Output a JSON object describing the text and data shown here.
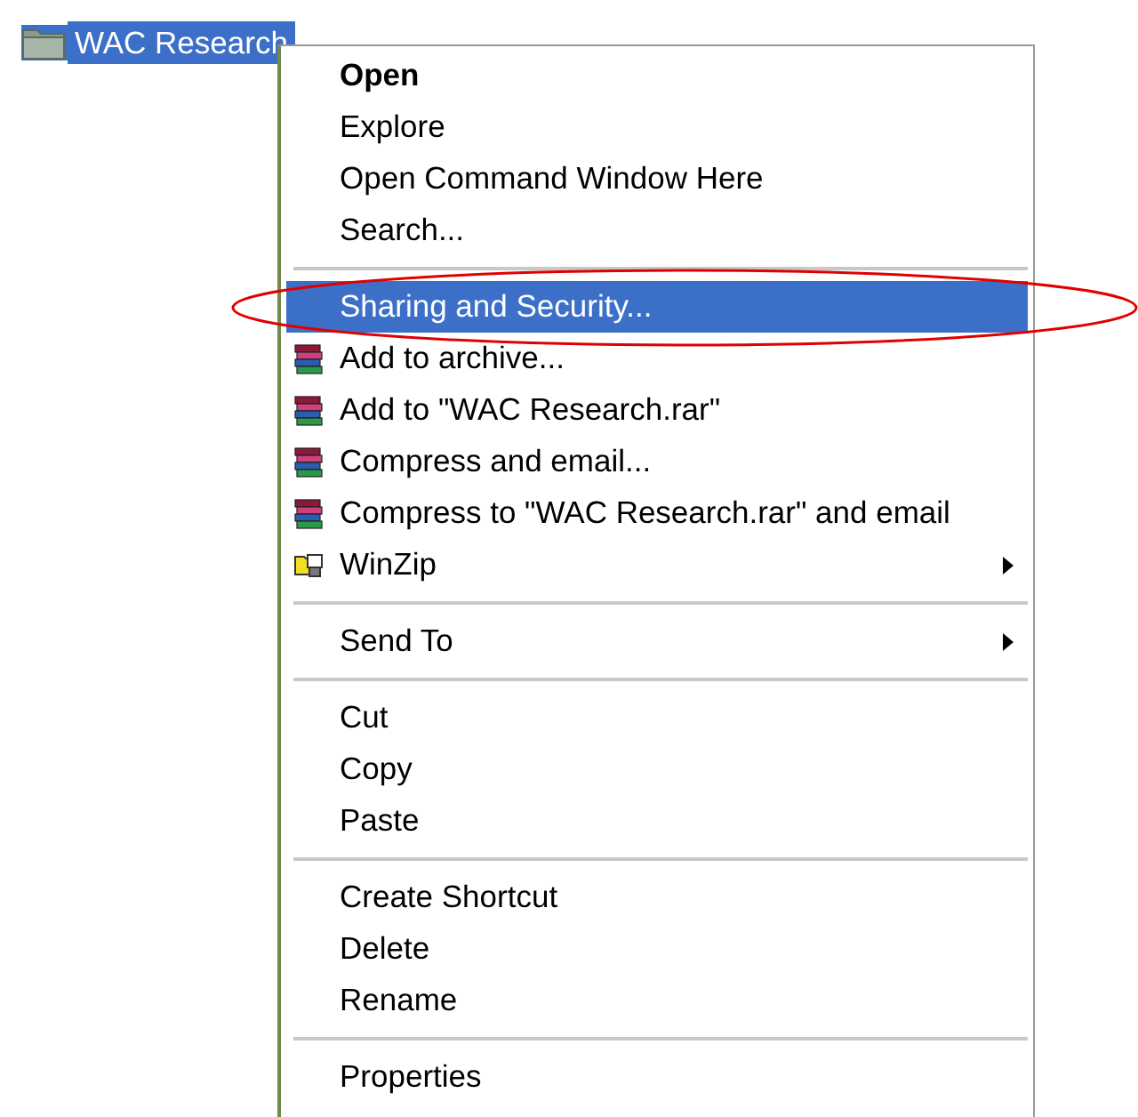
{
  "folder": {
    "name": "WAC Research",
    "selected": true
  },
  "menu": {
    "groups": [
      [
        {
          "label": "Open",
          "default": true,
          "selected": false
        },
        {
          "label": "Explore",
          "default": false,
          "selected": false
        },
        {
          "label": "Open Command Window Here",
          "default": false,
          "selected": false
        },
        {
          "label": "Search...",
          "default": false,
          "selected": false
        }
      ],
      [
        {
          "label": "Sharing and Security...",
          "default": false,
          "selected": true
        },
        {
          "label": "Add to archive...",
          "kind": "archive",
          "default": false,
          "selected": false
        },
        {
          "label": "Add to \"WAC Research.rar\"",
          "kind": "archive",
          "default": false,
          "selected": false
        },
        {
          "label": "Compress and email...",
          "kind": "archive",
          "default": false,
          "selected": false
        },
        {
          "label": "Compress to \"WAC Research.rar\" and email",
          "kind": "archive",
          "default": false,
          "selected": false
        },
        {
          "label": "WinZip",
          "kind": "zip",
          "submenu": true,
          "default": false,
          "selected": false
        }
      ],
      [
        {
          "label": "Send To",
          "submenu": true,
          "default": false,
          "selected": false
        }
      ],
      [
        {
          "label": "Cut",
          "default": false,
          "selected": false
        },
        {
          "label": "Copy",
          "default": false,
          "selected": false
        },
        {
          "label": "Paste",
          "default": false,
          "selected": false
        }
      ],
      [
        {
          "label": "Create Shortcut",
          "default": false,
          "selected": false
        },
        {
          "label": "Delete",
          "default": false,
          "selected": false
        },
        {
          "label": "Rename",
          "default": false,
          "selected": false
        }
      ],
      [
        {
          "label": "Properties",
          "default": false,
          "selected": false
        }
      ]
    ]
  }
}
